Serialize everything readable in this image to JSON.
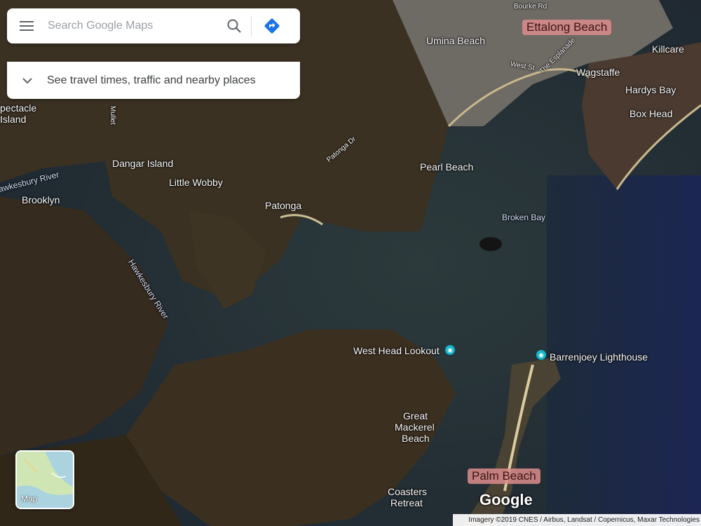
{
  "search": {
    "placeholder": "Search Google Maps",
    "menu_icon": "hamburger-menu-icon",
    "search_icon": "search-icon",
    "directions_icon": "directions-icon"
  },
  "travel_bar": {
    "text": "See travel times, traffic and nearby places",
    "icon": "chevron-down-icon"
  },
  "places": {
    "ettalong_beach": "Ettalong Beach",
    "palm_beach": "Palm Beach",
    "umina_beach": "Umina Beach",
    "killcare": "Killcare",
    "wagstaffe": "Wagstaffe",
    "hardys_bay": "Hardys Bay",
    "box_head": "Box Head",
    "pearl_beach": "Pearl Beach",
    "patonga": "Patonga",
    "little_wobby": "Little Wobby",
    "dangar_island": "Dangar Island",
    "brooklyn": "Brooklyn",
    "spectacle_island_line1": "pectacle",
    "spectacle_island_line2": "Island",
    "broken_bay": "Broken Bay",
    "hawkesbury_river_main": "Hawkesbury River",
    "hawkesbury_river_left": "awkesbury River",
    "west_head_lookout": "West Head Lookout",
    "barrenjoey_lighthouse": "Barrenjoey Lighthouse",
    "great_mackerel_beach_line1": "Great",
    "great_mackerel_beach_line2": "Mackerel",
    "great_mackerel_beach_line3": "Beach",
    "coasters_retreat_line1": "Coasters",
    "coasters_retreat_line2": "Retreat",
    "mullet_creek": "Mullet",
    "bourke_rd": "Bourke Rd",
    "west_st": "West St",
    "the_esplanade": "The Esplanade",
    "patonga_dr": "Patonga Dr"
  },
  "map_type_toggle": {
    "label": "Map"
  },
  "google_logo": "Google",
  "attribution": "Imagery ©2019 CNES / Airbus, Landsat / Copernicus, Maxar Technologies",
  "colors": {
    "water_deep": "#1a2433",
    "land_dark": "#3b3224",
    "pin_teal": "#12b5cb",
    "directions_blue": "#1a73e8",
    "highlight_pink": "#dc8c8c"
  }
}
